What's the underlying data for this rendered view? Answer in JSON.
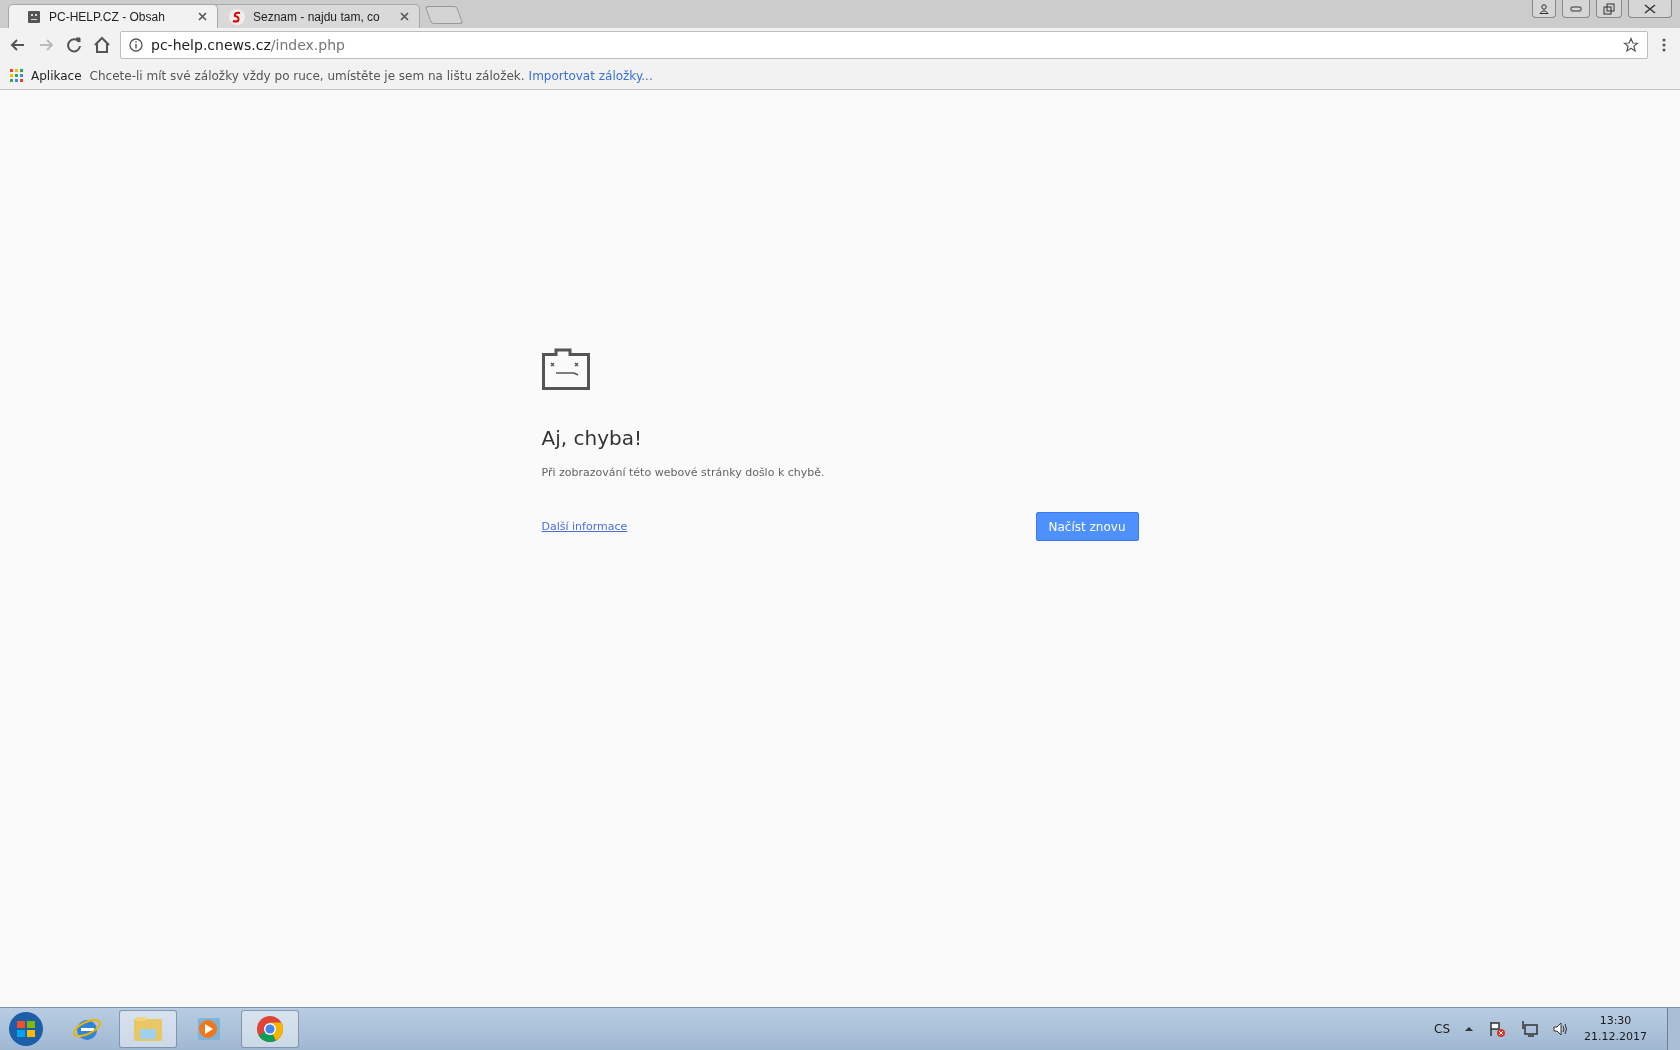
{
  "tabs": [
    {
      "title": "PC-HELP.CZ - Obsah",
      "kind": "sad-page",
      "selected": true
    },
    {
      "title": "Seznam - najdu tam, co",
      "kind": "s-logo",
      "selected": false
    }
  ],
  "address_bar": {
    "host": "pc-help.cnews.cz",
    "path": "/index.php"
  },
  "bookmarks_bar": {
    "apps_label": "Aplikace",
    "hint": "Chcete-li mít své záložky vždy po ruce, umístěte je sem na lištu záložek.",
    "import_link": "Importovat záložky..."
  },
  "error_page": {
    "title": "Aj, chyba!",
    "message": "Při zobrazování této webové stránky došlo k chybě.",
    "details_link": "Další informace",
    "reload_button": "Načíst znovu"
  },
  "taskbar": {
    "apps": [
      {
        "kind": "ie",
        "open": false
      },
      {
        "kind": "folder",
        "open": true
      },
      {
        "kind": "media",
        "open": false
      },
      {
        "kind": "chrome",
        "open": true
      }
    ],
    "language": "CS",
    "time": "13:30",
    "date": "21.12.2017"
  }
}
